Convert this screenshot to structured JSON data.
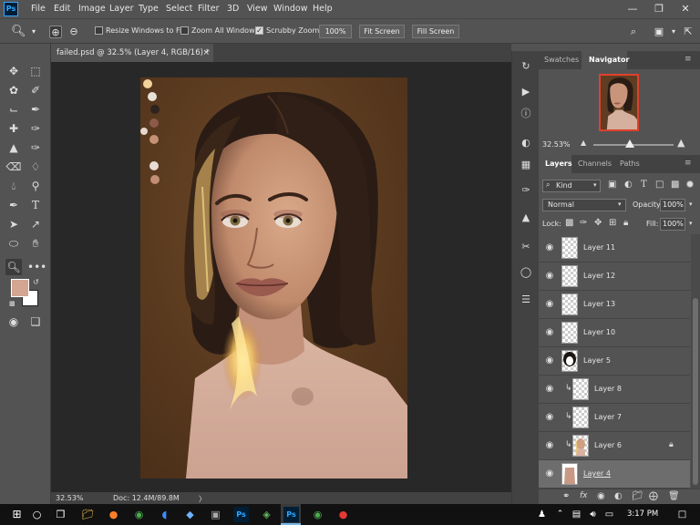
{
  "menubar": {
    "logo": "Ps",
    "items": [
      "File",
      "Edit",
      "Image",
      "Layer",
      "Type",
      "Select",
      "Filter",
      "3D",
      "View",
      "Window",
      "Help"
    ],
    "minimize": "—",
    "restore": "❐",
    "close": "✕"
  },
  "optionsbar": {
    "resize_windows_label": "Resize Windows to Fit",
    "resize_windows_checked": false,
    "zoom_all_label": "Zoom All Windows",
    "zoom_all_checked": false,
    "scrubby_zoom_label": "Scrubby Zoom",
    "scrubby_zoom_checked": true,
    "zoom_value": "100%",
    "fit_screen_label": "Fit Screen",
    "fill_screen_label": "Fill Screen"
  },
  "document": {
    "tab_title": "failed.psd @ 32.5% (Layer 4, RGB/16) *",
    "tab_close": "×"
  },
  "status": {
    "zoom": "32.53%",
    "doc_size": "Doc: 12.4M/89.8M",
    "arrow": "〉"
  },
  "colors": {
    "foreground": "#d4a590",
    "background": "#ffffff",
    "canvas_bg": "#5e3d22",
    "ps_blue": "#31a8ff"
  },
  "navigator_panel": {
    "tabs": [
      "Swatches",
      "Navigator"
    ],
    "active_tab": "Navigator",
    "zoom_value": "32.53%",
    "zoom_slider_fraction": 0.46
  },
  "layers_panel": {
    "tabs": [
      "Layers",
      "Channels",
      "Paths"
    ],
    "active_tab": "Layers",
    "filter_kind": "Kind",
    "blend_mode": "Normal",
    "opacity_label": "Opacity:",
    "opacity_value": "100%",
    "lock_label": "Lock:",
    "fill_label": "Fill:",
    "fill_value": "100%",
    "layers": [
      {
        "name": "Layer 11",
        "clipped": false,
        "selected": false,
        "locked": false,
        "thumb": "transparent"
      },
      {
        "name": "Layer 12",
        "clipped": false,
        "selected": false,
        "locked": false,
        "thumb": "transparent"
      },
      {
        "name": "Layer 13",
        "clipped": false,
        "selected": false,
        "locked": false,
        "thumb": "transparent"
      },
      {
        "name": "Layer 10",
        "clipped": false,
        "selected": false,
        "locked": false,
        "thumb": "transparent"
      },
      {
        "name": "Layer 5",
        "clipped": false,
        "selected": false,
        "locked": false,
        "thumb": "hair"
      },
      {
        "name": "Layer 8",
        "clipped": true,
        "selected": false,
        "locked": false,
        "thumb": "transparent"
      },
      {
        "name": "Layer 7",
        "clipped": true,
        "selected": false,
        "locked": false,
        "thumb": "transparent"
      },
      {
        "name": "Layer 6",
        "clipped": true,
        "selected": false,
        "locked": true,
        "thumb": "face"
      },
      {
        "name": "Layer 4",
        "clipped": false,
        "selected": true,
        "locked": false,
        "thumb": "skin"
      }
    ]
  },
  "taskbar": {
    "time": "3:17 PM"
  }
}
